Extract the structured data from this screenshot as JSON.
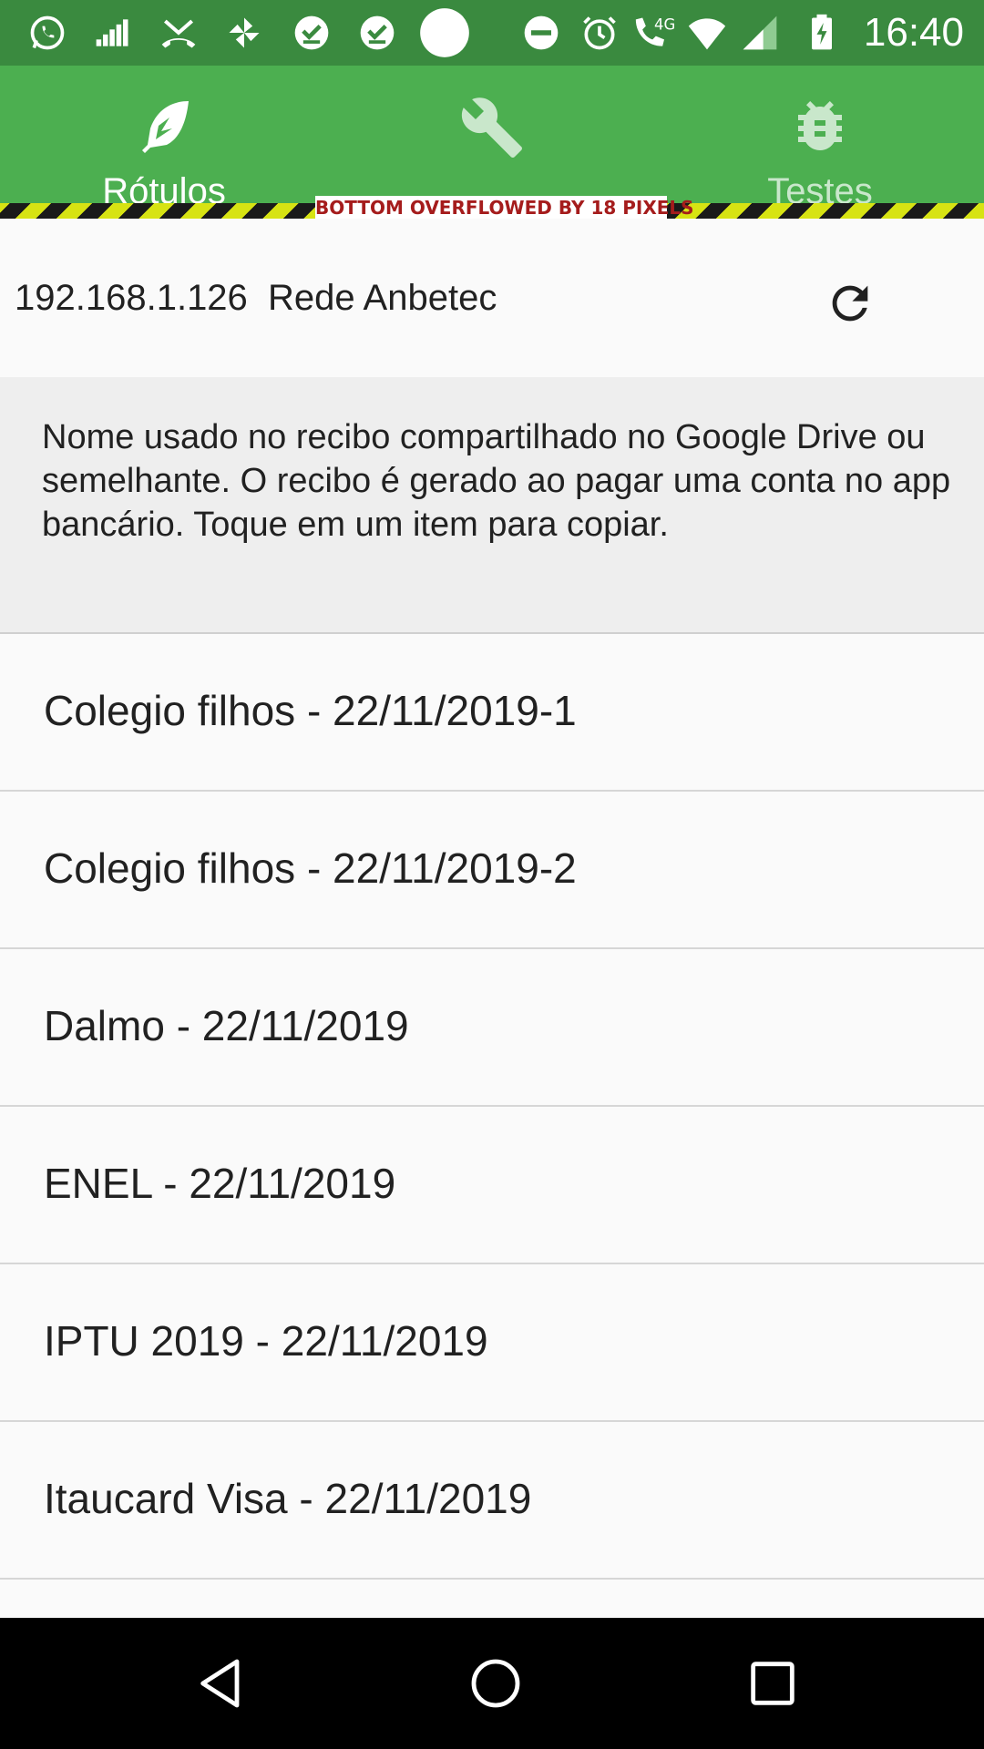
{
  "status_bar": {
    "time": "16:40",
    "network_type": "4G",
    "icons": [
      "whatsapp-icon",
      "equalizer-icon",
      "missed-call-icon",
      "pinwheel-icon",
      "check-circle-icon",
      "check-circle-icon",
      "circle-icon",
      "do-not-disturb-icon",
      "alarm-icon",
      "volte-call-icon",
      "wifi-icon",
      "signal-icon",
      "battery-charging-icon"
    ]
  },
  "tabs": [
    {
      "label": "Rótulos",
      "icon": "feather-icon"
    },
    {
      "label": "",
      "icon": "wrench-icon"
    },
    {
      "label": "Testes",
      "icon": "bug-icon"
    }
  ],
  "debug_banner": "BOTTOM OVERFLOWED BY 18 PIXELS",
  "network": {
    "ip": "192.168.1.126",
    "name": "Rede Anbetec",
    "display": "192.168.1.126  Rede Anbetec",
    "refresh_icon": "refresh-icon"
  },
  "info": {
    "text": "Nome usado no recibo compartilhado no Google Drive ou semelhante. O recibo é gerado ao pagar uma conta no app bancário. Toque em um item para copiar."
  },
  "receipts": [
    "Colegio filhos - 22/11/2019-1",
    "Colegio filhos - 22/11/2019-2",
    "Dalmo - 22/11/2019",
    "ENEL - 22/11/2019",
    "IPTU 2019 - 22/11/2019",
    "Itaucard Visa - 22/11/2019"
  ],
  "nav_bar": {
    "buttons": [
      "back-icon",
      "home-icon",
      "recents-icon"
    ]
  },
  "colors": {
    "status_bar": "#3a8a3f",
    "app_bar": "#4caf50",
    "background": "#fafafa",
    "info_background": "#eeeeee",
    "nav_bar": "#000000"
  }
}
